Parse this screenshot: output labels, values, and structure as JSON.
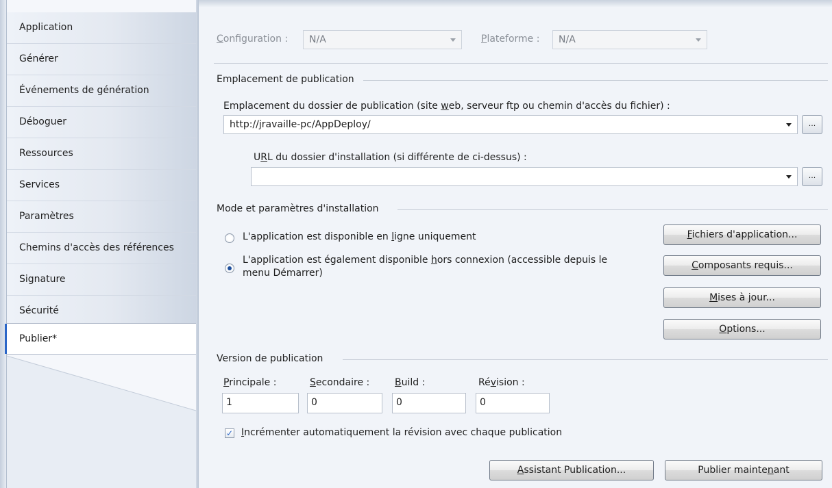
{
  "sidebar": {
    "items": [
      {
        "label": "Application"
      },
      {
        "label": "Générer"
      },
      {
        "label": "Événements de génération"
      },
      {
        "label": "Déboguer"
      },
      {
        "label": "Ressources"
      },
      {
        "label": "Services"
      },
      {
        "label": "Paramètres"
      },
      {
        "label": "Chemins d'accès des références"
      },
      {
        "label": "Signature"
      },
      {
        "label": "Sécurité"
      },
      {
        "label": "Publier*"
      }
    ],
    "selected": "Publier*"
  },
  "config": {
    "configuration_label": "onfiguration :",
    "configuration_label_mn": "C",
    "configuration_value": "N/A",
    "platform_label": "lateforme :",
    "platform_label_mn": "P",
    "platform_value": "N/A"
  },
  "publish_location": {
    "group_title": "Emplacement de publication",
    "folder_label_pre": "Emplacement du dossier de publication (site ",
    "folder_label_mn": "w",
    "folder_label_post": "eb, serveur ftp ou chemin d'accès du fichier) :",
    "folder_value": "http://jravaille-pc/AppDeploy/",
    "browse_label": "...",
    "url_label_pre": "U",
    "url_label_mn": "R",
    "url_label_post": "L du dossier d'installation (si différente de ci-dessus) :",
    "url_value": ""
  },
  "install_mode": {
    "group_title": "Mode et paramètres d'installation",
    "online_only_pre": "L'application est disponible en ",
    "online_only_mn": "l",
    "online_only_post": "igne uniquement",
    "offline_pre": "L'application est également disponible ",
    "offline_mn": "h",
    "offline_post": "ors connexion (accessible depuis le",
    "offline_line2": "menu Démarrer)",
    "selected": "offline",
    "buttons": {
      "app_files_mn": "F",
      "app_files_rest": "ichiers d'application...",
      "prereq_mn": "C",
      "prereq_rest": "omposants requis...",
      "updates_mn": "M",
      "updates_rest": "ises à jour...",
      "options_mn": "O",
      "options_rest": "ptions..."
    }
  },
  "version": {
    "group_title": "Version de publication",
    "major_mn": "P",
    "major_label": "rincipale :",
    "minor_mn": "S",
    "minor_label": "econdaire :",
    "build_mn": "B",
    "build_label": "uild :",
    "revision_pre": "Ré",
    "revision_mn": "v",
    "revision_post": "ision :",
    "major": "1",
    "minor": "0",
    "build": "0",
    "revision": "0",
    "auto_increment_mn": "I",
    "auto_increment_rest": "ncrémenter automatiquement la révision avec chaque publication",
    "auto_increment_checked": true,
    "check_glyph": "✓"
  },
  "footer": {
    "wizard_mn": "A",
    "wizard_rest": "ssistant Publication...",
    "publish_pre": "Publier mainte",
    "publish_mn": "n",
    "publish_post": "ant"
  }
}
